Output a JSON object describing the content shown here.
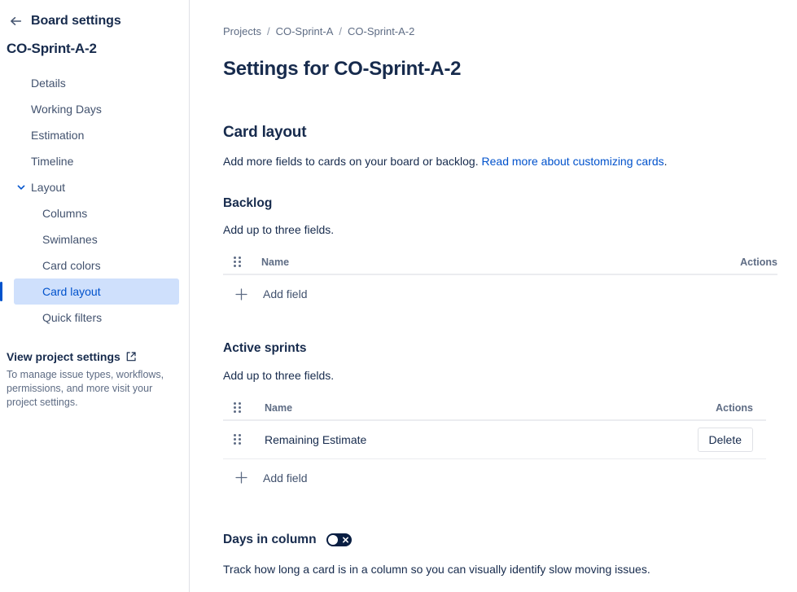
{
  "sidebar": {
    "back_label": "Board settings",
    "board_name": "CO-Sprint-A-2",
    "items": [
      {
        "label": "Details",
        "level": 1,
        "selected": false,
        "chevron": ""
      },
      {
        "label": "Working Days",
        "level": 1,
        "selected": false,
        "chevron": ""
      },
      {
        "label": "Estimation",
        "level": 1,
        "selected": false,
        "chevron": ""
      },
      {
        "label": "Timeline",
        "level": 1,
        "selected": false,
        "chevron": ""
      },
      {
        "label": "Layout",
        "level": 1,
        "selected": false,
        "chevron": "down"
      },
      {
        "label": "Columns",
        "level": 2,
        "selected": false,
        "chevron": ""
      },
      {
        "label": "Swimlanes",
        "level": 2,
        "selected": false,
        "chevron": ""
      },
      {
        "label": "Card colors",
        "level": 2,
        "selected": false,
        "chevron": ""
      },
      {
        "label": "Card layout",
        "level": 2,
        "selected": true,
        "chevron": ""
      },
      {
        "label": "Quick filters",
        "level": 2,
        "selected": false,
        "chevron": ""
      }
    ],
    "project_settings_link": "View project settings",
    "project_settings_desc": "To manage issue types, workflows, permissions, and more visit your project settings."
  },
  "breadcrumb": {
    "items": [
      "Projects",
      "CO-Sprint-A",
      "CO-Sprint-A-2"
    ],
    "separator": "/"
  },
  "page": {
    "title": "Settings for CO-Sprint-A-2"
  },
  "card_layout": {
    "heading": "Card layout",
    "desc_before_link": "Add more fields to cards on your board or backlog. ",
    "link_text": "Read more about customizing cards",
    "desc_after_link": "."
  },
  "backlog": {
    "heading": "Backlog",
    "desc": "Add up to three fields.",
    "columns": {
      "name": "Name",
      "actions": "Actions"
    },
    "rows": [],
    "add_field_label": "Add field"
  },
  "active_sprints": {
    "heading": "Active sprints",
    "desc": "Add up to three fields.",
    "columns": {
      "name": "Name",
      "actions": "Actions"
    },
    "rows": [
      {
        "name": "Remaining Estimate",
        "action_label": "Delete"
      }
    ],
    "add_field_label": "Add field"
  },
  "days_in_column": {
    "title": "Days in column",
    "toggle_state": "off",
    "desc": "Track how long a card is in a column so you can visually identify slow moving issues."
  },
  "colors": {
    "accent": "#0052cc",
    "selected_bg": "#cfe0fc",
    "text": "#172b4d",
    "muted": "#5e6c84",
    "border": "#dfe1e6",
    "toggle_off": "#091e42"
  }
}
